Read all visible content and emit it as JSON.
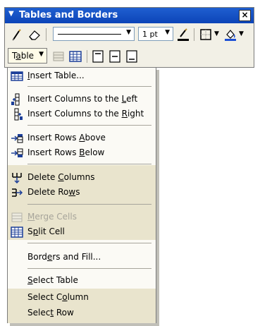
{
  "toolbar": {
    "title": "Tables and Borders",
    "close_label": "×",
    "line_weight": "1 pt",
    "table_button": {
      "label_prefix": "T",
      "label_ul": "a",
      "label_suffix": "ble"
    }
  },
  "menu": {
    "insert_table": {
      "pre": "",
      "ul": "I",
      "post": "nsert Table..."
    },
    "insert_cols_left": {
      "pre": "Insert Columns to the ",
      "ul": "L",
      "post": "eft"
    },
    "insert_cols_right": {
      "pre": "Insert Columns to the ",
      "ul": "R",
      "post": "ight"
    },
    "insert_rows_above": {
      "pre": "Insert Rows ",
      "ul": "A",
      "post": "bove"
    },
    "insert_rows_below": {
      "pre": "Insert Rows ",
      "ul": "B",
      "post": "elow"
    },
    "delete_columns": {
      "pre": "Delete ",
      "ul": "C",
      "post": "olumns"
    },
    "delete_rows": {
      "pre": "Delete Ro",
      "ul": "w",
      "post": "s"
    },
    "merge_cells": {
      "pre": "",
      "ul": "M",
      "post": "erge Cells"
    },
    "split_cell": {
      "pre": "S",
      "ul": "p",
      "post": "lit Cell"
    },
    "borders_fill": {
      "pre": "Bord",
      "ul": "e",
      "post": "rs and Fill..."
    },
    "select_table": {
      "pre": "",
      "ul": "S",
      "post": "elect Table"
    },
    "select_column": {
      "pre": "Select C",
      "ul": "o",
      "post": "lumn"
    },
    "select_row": {
      "pre": "Selec",
      "ul": "t",
      "post": " Row"
    }
  }
}
